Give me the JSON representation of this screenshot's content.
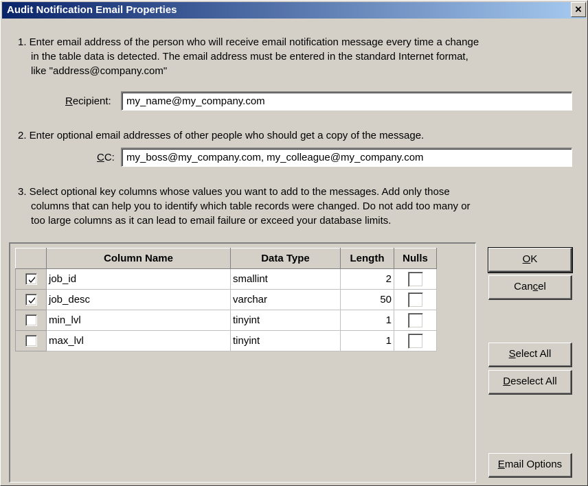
{
  "window": {
    "title": "Audit Notification Email Properties",
    "close_label": "×"
  },
  "instructions": {
    "step1": [
      "1. Enter email address of the person who will receive email notification message every time a change",
      "in the table data is detected. The email address must be entered in the standard Internet format,",
      "like \"address@company.com\""
    ],
    "step2": "2. Enter optional email addresses of other people who should get a copy of the message.",
    "step3": [
      "3. Select optional key columns whose values you want to add to the messages. Add only those",
      "columns that can help you to identify which table records were changed. Do not add too many or",
      "too large columns as it can lead to email failure or exceed your database limits."
    ]
  },
  "recipient": {
    "label_accel": "R",
    "label_rest": "ecipient:",
    "value": "my_name@my_company.com"
  },
  "cc": {
    "label_accel": "C",
    "label_rest": "C:",
    "value": "my_boss@my_company.com, my_colleague@my_company.com"
  },
  "grid": {
    "columns": [
      "Column Name",
      "Data Type",
      "Length",
      "Nulls"
    ],
    "rows": [
      {
        "checked": true,
        "name": "job_id",
        "type": "smallint",
        "length": "2",
        "nulls": false
      },
      {
        "checked": true,
        "name": "job_desc",
        "type": "varchar",
        "length": "50",
        "nulls": false
      },
      {
        "checked": false,
        "name": "min_lvl",
        "type": "tinyint",
        "length": "1",
        "nulls": false
      },
      {
        "checked": false,
        "name": "max_lvl",
        "type": "tinyint",
        "length": "1",
        "nulls": false
      }
    ]
  },
  "buttons": {
    "ok": {
      "accel": "O",
      "rest": "K"
    },
    "cancel": {
      "pre": "Can",
      "accel": "c",
      "rest": "el"
    },
    "select_all": {
      "accel": "S",
      "rest": "elect All"
    },
    "deselect_all": {
      "accel": "D",
      "rest": "eselect All"
    },
    "email_options": {
      "accel": "E",
      "rest": "mail Options"
    }
  }
}
